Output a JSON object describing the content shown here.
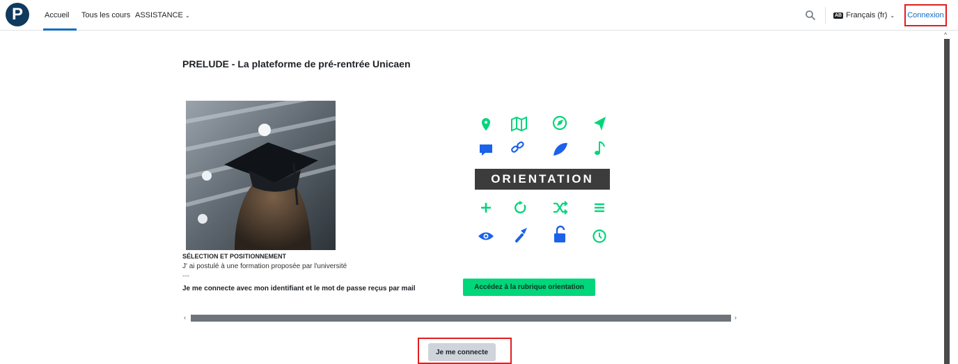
{
  "header": {
    "logo_letter": "P",
    "nav": [
      "Accueil",
      "Tous les cours",
      "ASSISTANCE"
    ],
    "language_badge": "AB",
    "language": "Français (fr)",
    "login_link": "Connexion"
  },
  "main": {
    "title": "PRELUDE - La plateforme de pré-rentrée Unicaen",
    "caption_title": "SÉLECTION ET POSITIONNEMENT",
    "caption_text": "J' ai postulé à une formation proposée par l'université",
    "caption_separator": "---",
    "caption_connect": "Je me connecte avec mon  identifiant et le mot de passe  reçus par mail",
    "orientation_label": "ORIENTATION",
    "orientation_button": "Accédez à la rubrique orientation",
    "login_button": "Je me connecte"
  },
  "icons": {
    "orientation_row1": [
      "map-marker-icon",
      "map-icon",
      "compass-icon",
      "location-arrow-icon"
    ],
    "orientation_row2": [
      "comment-icon",
      "link-icon",
      "leaf-icon",
      "music-icon"
    ],
    "orientation_row3": [
      "plus-icon",
      "refresh-icon",
      "shuffle-icon",
      "bars-icon"
    ],
    "orientation_row4": [
      "eye-icon",
      "flashlight-icon",
      "unlock-icon",
      "clock-icon"
    ]
  },
  "colors": {
    "brand_dark": "#0f3a5e",
    "link_blue": "#0f6cbf",
    "icon_green": "#00d67a",
    "icon_blue": "#1a62e8",
    "highlight_red": "#e11d1d"
  }
}
